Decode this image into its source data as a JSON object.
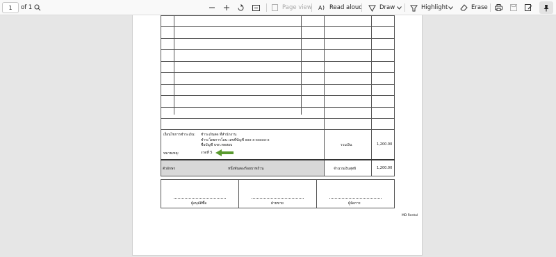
{
  "toolbar": {
    "page_number": "1",
    "page_of": "of 1",
    "page_view": "Page view",
    "read_aloud": "Read aloud",
    "draw": "Draw",
    "highlight": "Highlight",
    "erase": "Erase"
  },
  "document": {
    "payment_condition_label": "เงื่อนไขการชำระเงิน:",
    "payment_line1": "ชำระเงินสด ที่สำนักงาน",
    "payment_line2": "ชำระโดยการโอน เลขที่บัญชี xxx-x-xxxxx-x",
    "payment_line3": "ชื่อบัญชี บจก.ทดสอบ",
    "remark_label": "หมายเหตุ:",
    "remark_value": "งวดที่ 5",
    "total_label": "รวมเงิน",
    "total_value": "1,200.00",
    "amount_words_label": "ตัวอักษร",
    "amount_words": "หนึ่งพันสองร้อยบาทถ้วน",
    "net_total_label": "จำนวนเงินสุทธิ",
    "net_total_value": "1,200.00",
    "signatures": [
      "ผู้อนุมัติซื้อ",
      "ฝ่ายขาย",
      "ผู้จัดการ"
    ],
    "footer_note": "MD Rental"
  },
  "colors": {
    "arrow": "#5a9a2f",
    "grey_cell": "#d8d8d8"
  }
}
